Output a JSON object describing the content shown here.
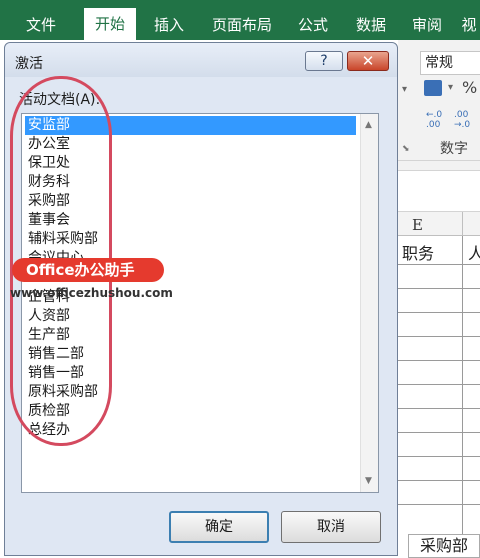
{
  "ribbon": {
    "tabs": [
      "文件",
      "开始",
      "插入",
      "页面布局",
      "公式",
      "数据",
      "审阅",
      "视"
    ],
    "active": "开始"
  },
  "excel": {
    "number_format": "常规",
    "group_label": "数字",
    "column_header": "E",
    "cell_e1": "职务",
    "cell_f1": "人",
    "sheet_tab": "采购部",
    "icons": {
      "dec_increase": "←.0 .00",
      "dec_decrease": ".00 →.0",
      "percent": "%"
    }
  },
  "dialog": {
    "title": "激活",
    "help_label": "?",
    "close_label": "✕",
    "list_label": "活动文档(A):",
    "items": [
      "安监部",
      "办公室",
      "保卫处",
      "财务科",
      "采购部",
      "董事会",
      "辅料采购部",
      "会议中心",
      "企管科",
      "人资部",
      "生产部",
      "销售二部",
      "销售一部",
      "原料采购部",
      "质检部",
      "总经办"
    ],
    "selected_index": 0,
    "ok_label": "确定",
    "cancel_label": "取消"
  },
  "watermark": {
    "badge": "Office办公助手",
    "url": "www.officezhushou.com"
  },
  "colors": {
    "excel_green": "#217346",
    "selection": "#3399ff",
    "annotation": "#d44a5f",
    "watermark_red": "#e53a2e"
  }
}
